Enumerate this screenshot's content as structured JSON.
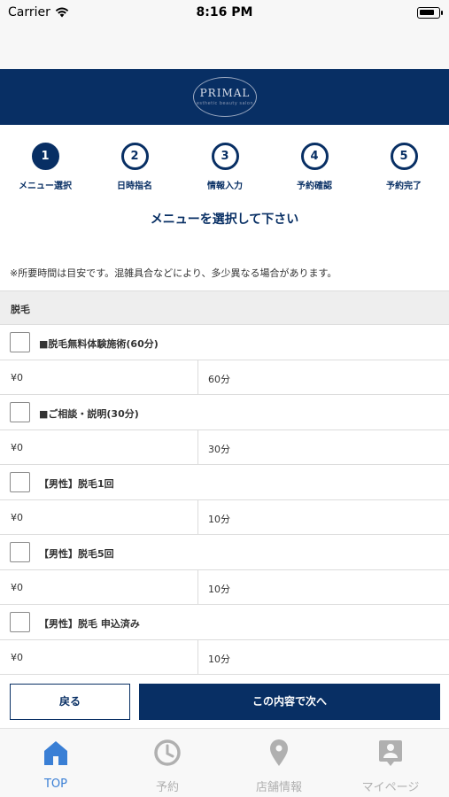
{
  "status_bar": {
    "carrier": "Carrier",
    "time": "8:16 PM"
  },
  "header": {
    "logo_text": "PRIMAL",
    "logo_subtext": "esthetic beauty salon"
  },
  "steps": [
    {
      "number": "1",
      "label": "メニュー選択",
      "active": true
    },
    {
      "number": "2",
      "label": "日時指名",
      "active": false
    },
    {
      "number": "3",
      "label": "情報入力",
      "active": false
    },
    {
      "number": "4",
      "label": "予約確認",
      "active": false
    },
    {
      "number": "5",
      "label": "予約完了",
      "active": false
    }
  ],
  "page_title": "メニューを選択して下さい",
  "note": "※所要時間は目安です。混雑具合などにより、多少異なる場合があります。",
  "category": "脱毛",
  "menu_items": [
    {
      "name": "■脱毛無料体験施術(60分)",
      "price": "¥0",
      "duration": "60分",
      "checked": false
    },
    {
      "name": "■ご相談・説明(30分)",
      "price": "¥0",
      "duration": "30分",
      "checked": false
    },
    {
      "name": "【男性】脱毛1回",
      "price": "¥0",
      "duration": "10分",
      "checked": false
    },
    {
      "name": "【男性】脱毛5回",
      "price": "¥0",
      "duration": "10分",
      "checked": false
    },
    {
      "name": "【男性】脱毛 申込済み",
      "price": "¥0",
      "duration": "10分",
      "checked": false
    }
  ],
  "buttons": {
    "back": "戻る",
    "next": "この内容で次へ"
  },
  "tab_bar": {
    "active_color": "#3a7fd5",
    "inactive_color": "#b0b0b0",
    "tabs": [
      {
        "label": "TOP",
        "icon": "home-icon",
        "active": true
      },
      {
        "label": "予約",
        "icon": "clock-icon",
        "active": false
      },
      {
        "label": "店舗情報",
        "icon": "map-pin-icon",
        "active": false
      },
      {
        "label": "マイページ",
        "icon": "profile-card-icon",
        "active": false
      }
    ]
  },
  "colors": {
    "brand_navy": "#082f64"
  }
}
